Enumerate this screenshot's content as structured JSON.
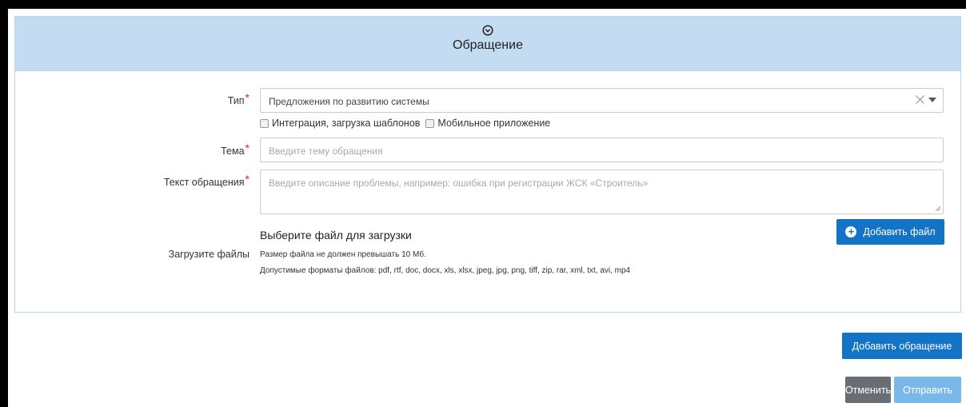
{
  "panel": {
    "title": "Обращение"
  },
  "form": {
    "type": {
      "label": "Тип",
      "required_mark": "*",
      "value": "Предложения по развитию системы"
    },
    "checkboxes": [
      {
        "label": "Интеграция, загрузка шаблонов",
        "checked": false
      },
      {
        "label": "Мобильное приложение",
        "checked": false
      }
    ],
    "topic": {
      "label": "Тема",
      "required_mark": "*",
      "placeholder": "Введите тему обращения"
    },
    "text": {
      "label": "Текст обращения",
      "required_mark": "*",
      "placeholder": "Введите описание проблемы, например: ошибка при регистрации ЖСК «Строитель»"
    },
    "upload": {
      "label": "Загрузите файлы",
      "title": "Выберите файл для загрузки",
      "size_note": "Размер файла не должен превышать 10 Мб.",
      "formats_note": "Допустимые форматы файлов: pdf, rtf, doc, docx, xls, xlsx, jpeg, jpg, png, tiff, zip, rar, xml, txt, avi, mp4",
      "add_button": "Добавить файл"
    }
  },
  "actions": {
    "add_request": "Добавить обращение",
    "cancel": "Отменить",
    "submit": "Отправить"
  },
  "colors": {
    "header_bg": "#c3dcf1",
    "primary": "#1373c7",
    "secondary": "#686e74",
    "disabled_primary": "#7ab8ea",
    "required": "#d9262f"
  }
}
